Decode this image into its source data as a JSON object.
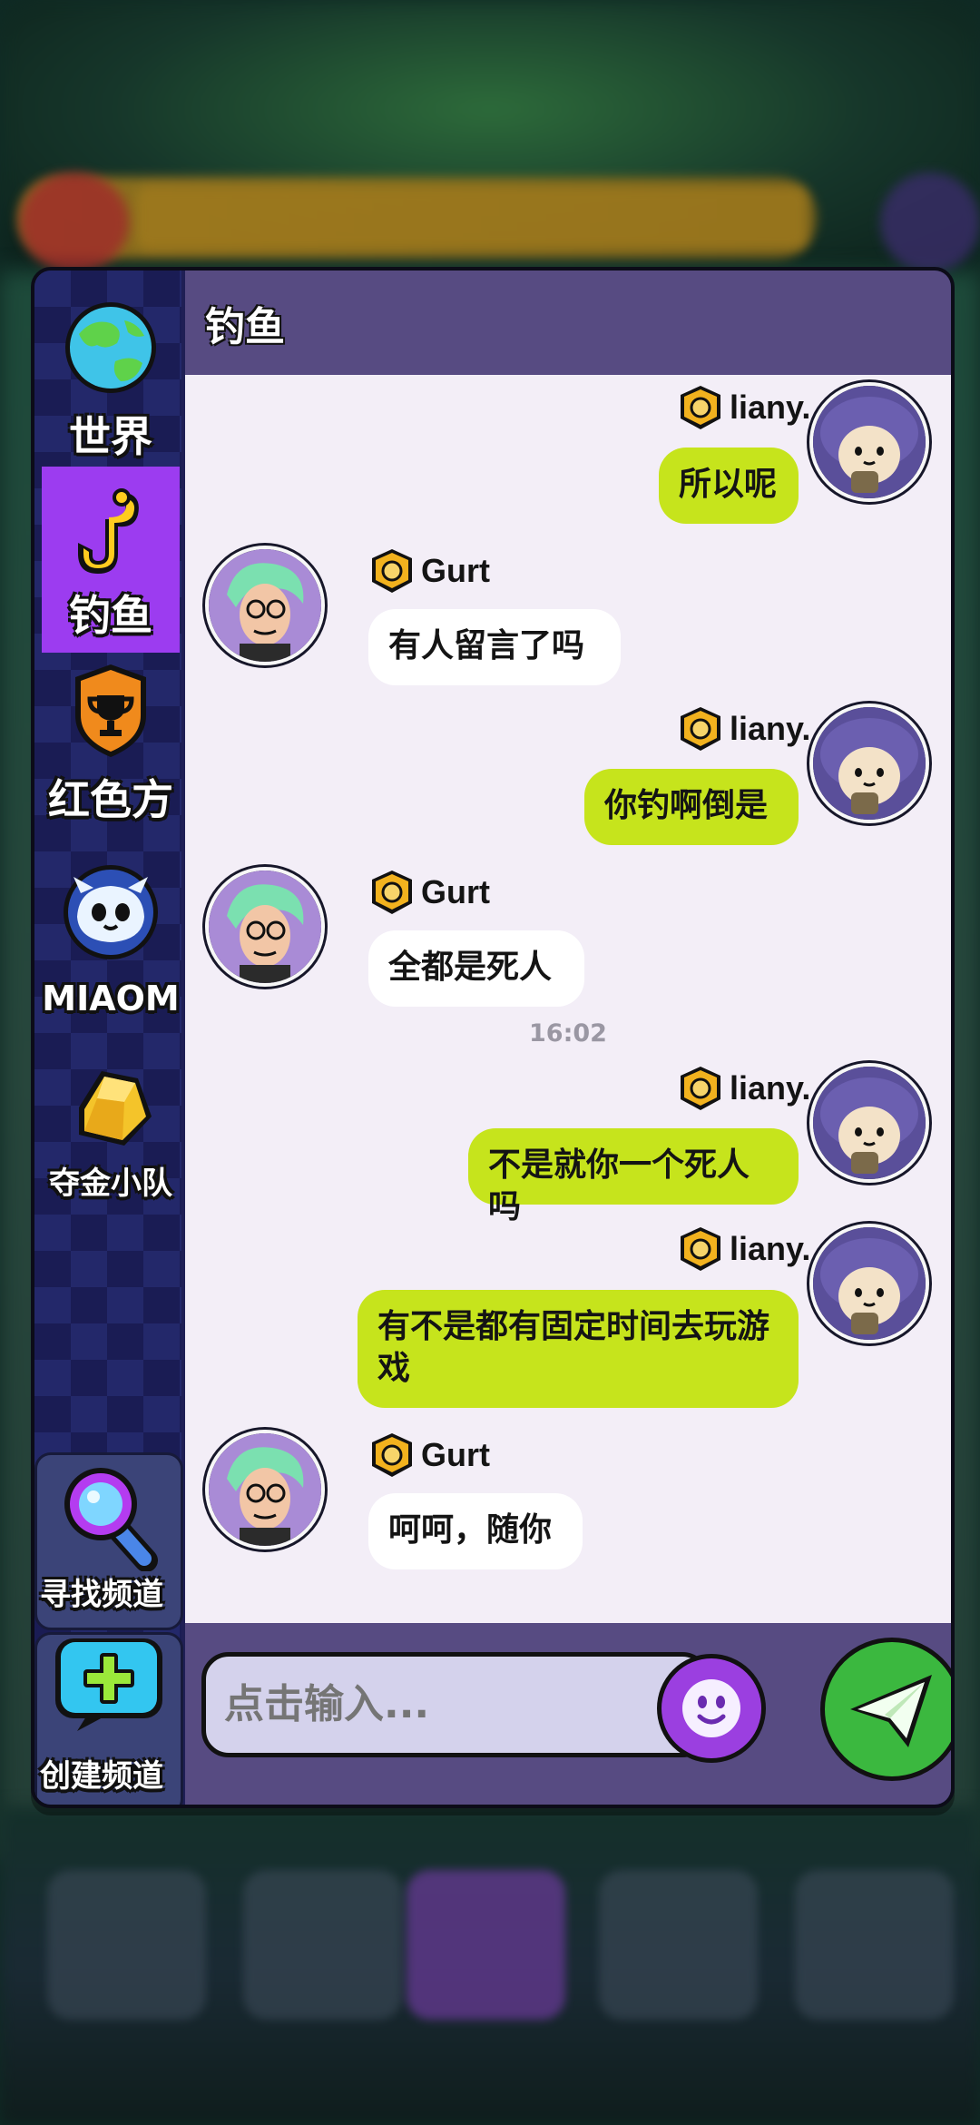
{
  "sidebar": {
    "channels": [
      {
        "label": "世界",
        "icon": "globe-icon"
      },
      {
        "label": "钓鱼",
        "icon": "fishing-hook-icon",
        "active": true
      },
      {
        "label": "红色方",
        "icon": "trophy-shield-icon"
      },
      {
        "label": "MIAOM",
        "icon": "ghost-cat-icon"
      },
      {
        "label": "夺金小队",
        "icon": "gold-nugget-icon"
      }
    ],
    "find_channel": "寻找频道",
    "create_channel": "创建频道"
  },
  "chat": {
    "title": "钓鱼",
    "messages": [
      {
        "sender": "liany.",
        "text": "所以呢",
        "mine": true
      },
      {
        "sender": "Gurt",
        "text": "有人留言了吗",
        "mine": false
      },
      {
        "sender": "liany.",
        "text": "你钓啊倒是",
        "mine": true
      },
      {
        "sender": "Gurt",
        "text": "全都是死人",
        "mine": false
      },
      {
        "timestamp": "16:02"
      },
      {
        "sender": "liany.",
        "text": "不是就你一个死人吗",
        "mine": true
      },
      {
        "sender": "liany.",
        "text": "有不是都有固定时间去玩游戏",
        "mine": true
      },
      {
        "sender": "Gurt",
        "text": "呵呵，随你",
        "mine": false
      }
    ]
  },
  "composer": {
    "placeholder": "点击输入..."
  },
  "colors": {
    "active_tab": "#9c3cf0",
    "my_bubble": "#c6e41c",
    "their_bubble": "#ffffff",
    "header": "#574b82",
    "send_button": "#3bb83f"
  }
}
